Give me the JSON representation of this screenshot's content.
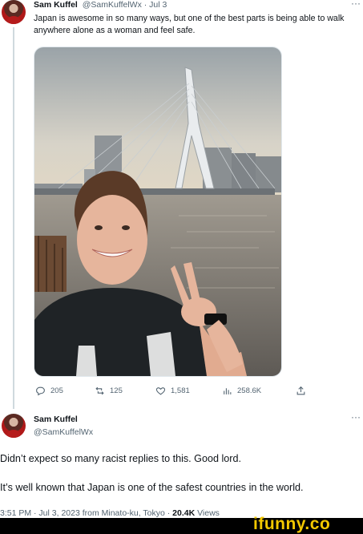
{
  "tweet1": {
    "author_name": "Sam Kuffel",
    "handle_date": "@SamKuffelWx · Jul 3",
    "more_label": "···",
    "text": "Japan is awesome in so many ways, but one of the best parts is being able to walk anywhere alone as a woman and feel safe.",
    "actions": {
      "replies": "205",
      "retweets": "125",
      "likes": "1,581",
      "views": "258.6K"
    },
    "icons": [
      "reply-icon",
      "retweet-icon",
      "like-icon",
      "views-icon",
      "share-icon"
    ]
  },
  "tweet2": {
    "author_name": "Sam Kuffel",
    "handle": "@SamKuffelWx",
    "more_label": "···",
    "paragraph1": "Didn’t expect so many racist replies to this. Good lord.",
    "paragraph2": "It’s well known that Japan is one of the safest countries in the world.",
    "meta_time": "3:51 PM · Jul 3, 2023 from Minato-ku, Tokyo · ",
    "views_count": "20.4K",
    "views_label": " Views"
  },
  "watermark": {
    "text": "ifunny.co"
  },
  "colors": {
    "accent": "#1d9bf0",
    "muted": "#536471",
    "watermark": "#f3c800"
  }
}
